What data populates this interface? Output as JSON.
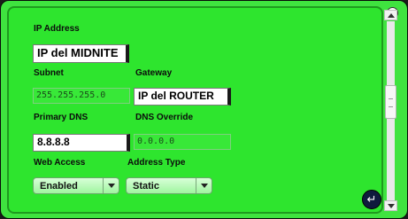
{
  "labels": {
    "ip_address": "IP Address",
    "subnet": "Subnet",
    "gateway": "Gateway",
    "primary_dns": "Primary DNS",
    "dns_override": "DNS Override",
    "web_access": "Web Access",
    "address_type": "Address Type"
  },
  "fields": {
    "ip_address": "IP del MIDNITE",
    "subnet": "255.255.255.0",
    "gateway": "IP del ROUTER",
    "primary_dns": "8.8.8.8",
    "dns_override": "0.0.0.0"
  },
  "selects": {
    "web_access": "Enabled",
    "address_type": "Static"
  },
  "icons": {
    "enter": "↵"
  },
  "colors": {
    "panel_green": "#2ee52e",
    "frame_green": "#1f9a1f"
  }
}
